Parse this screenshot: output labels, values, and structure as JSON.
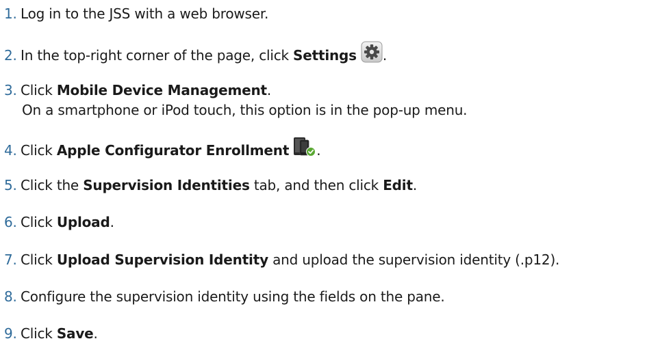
{
  "steps": [
    {
      "num": "1.",
      "pre": "Log in to the JSS with a web browser."
    },
    {
      "num": "2.",
      "pre": "In the top-right corner of the page, click ",
      "bold": "Settings",
      "post": ".",
      "icon": "gear-icon"
    },
    {
      "num": "3.",
      "pre": "Click ",
      "bold": "Mobile Device Management",
      "post": ".",
      "note": "On a smartphone or iPod touch, this option is in the pop-up menu."
    },
    {
      "num": "4.",
      "pre": "Click ",
      "bold": "Apple Configurator Enrollment",
      "post": ".",
      "icon": "mobile-device-check-icon"
    },
    {
      "num": "5.",
      "pre": "Click the ",
      "bold": "Supervision Identities",
      "mid": " tab, and then click ",
      "bold2": "Edit",
      "post": "."
    },
    {
      "num": "6.",
      "pre": "Click ",
      "bold": "Upload",
      "post": "."
    },
    {
      "num": "7.",
      "pre": "Click ",
      "bold": "Upload Supervision Identity",
      "post": " and upload the supervision identity (.p12)."
    },
    {
      "num": "8.",
      "pre": "Configure the supervision identity using the fields on the pane."
    },
    {
      "num": "9.",
      "pre": "Click ",
      "bold": "Save",
      "post": "."
    }
  ],
  "colors": {
    "number": "#2f6b9a",
    "text": "#1a1a1a"
  }
}
